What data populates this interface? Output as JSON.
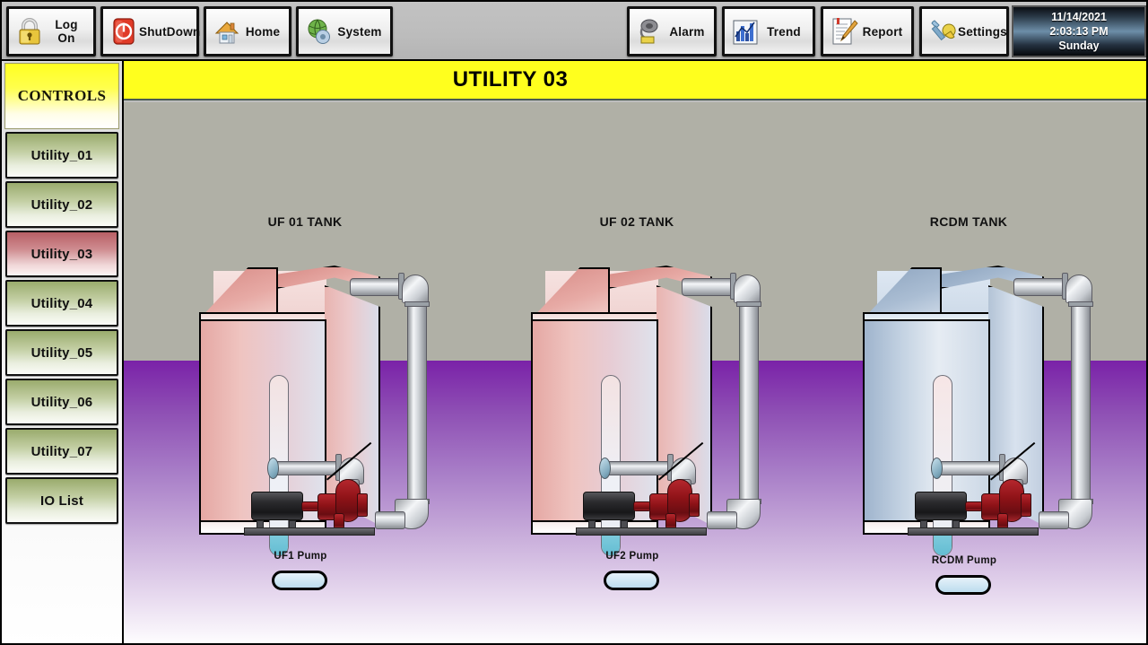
{
  "toolbar": {
    "buttons": [
      {
        "label": "Log On",
        "icon": "padlock-icon"
      },
      {
        "label": "ShutDown",
        "icon": "power-icon"
      },
      {
        "label": "Home",
        "icon": "house-icon"
      },
      {
        "label": "System",
        "icon": "globe-gear-icon"
      },
      {
        "label": "Alarm",
        "icon": "alarm-bell-icon"
      },
      {
        "label": "Trend",
        "icon": "bar-chart-icon"
      },
      {
        "label": "Report",
        "icon": "document-pencil-icon"
      },
      {
        "label": "Settings",
        "icon": "tools-icon"
      }
    ],
    "clock": {
      "date": "11/14/2021",
      "time": "2:03:13 PM",
      "day": "Sunday"
    }
  },
  "sidebar": {
    "header": "CONTROLS",
    "items": [
      {
        "label": "Utility_01",
        "active": false
      },
      {
        "label": "Utility_02",
        "active": false
      },
      {
        "label": "Utility_03",
        "active": true
      },
      {
        "label": "Utility_04",
        "active": false
      },
      {
        "label": "Utility_05",
        "active": false
      },
      {
        "label": "Utility_06",
        "active": false
      },
      {
        "label": "Utility_07",
        "active": false
      },
      {
        "label": "IO List",
        "active": false
      }
    ]
  },
  "screen": {
    "title": "UTILITY 03",
    "title_bg": "#ffff1e",
    "wall_color": "#b0b0a6",
    "floor_color": "#7a22a8"
  },
  "tanks": [
    {
      "name": "UF 01 TANK",
      "tint": "pink",
      "level_percent": 12,
      "gauge_liquid_color": "#7fcbdd",
      "pump": {
        "label": "UF1 Pump",
        "lamp_color": "#cfe6f3",
        "running": false
      }
    },
    {
      "name": "UF 02 TANK",
      "tint": "pink",
      "level_percent": 12,
      "gauge_liquid_color": "#7fcbdd",
      "pump": {
        "label": "UF2 Pump",
        "lamp_color": "#cfe6f3",
        "running": false
      }
    },
    {
      "name": "RCDM TANK",
      "tint": "blue",
      "level_percent": 12,
      "gauge_liquid_color": "#7fcbdd",
      "pump": {
        "label": "RCDM Pump",
        "lamp_color": "#cfe6f3",
        "running": false
      }
    }
  ]
}
